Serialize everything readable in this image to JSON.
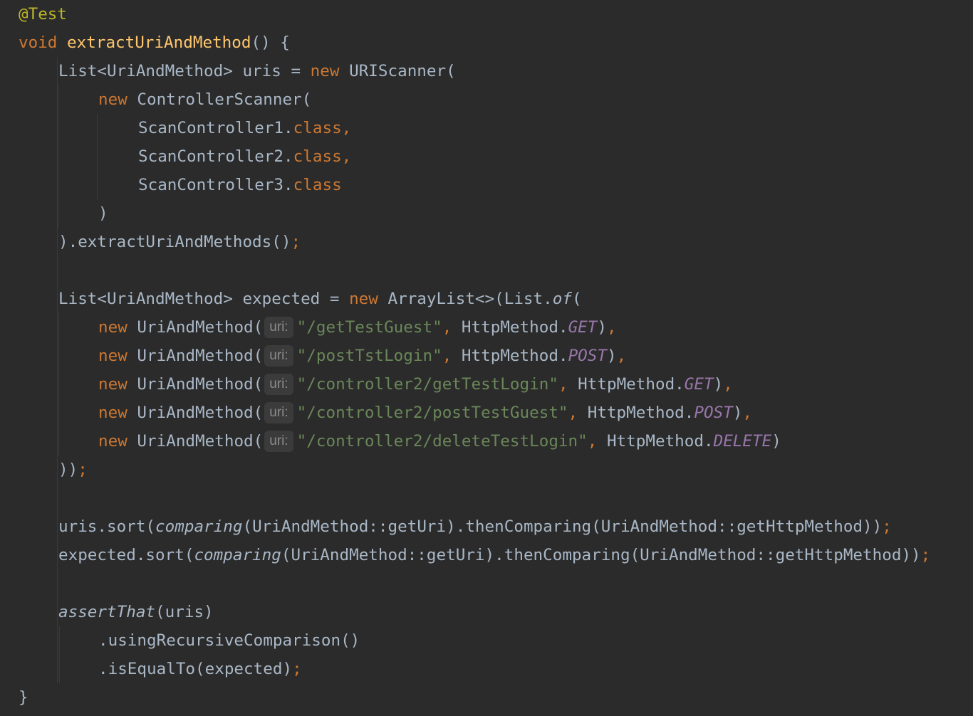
{
  "code": {
    "annotation": "@Test",
    "kw_void": "void",
    "method_name": "extractUriAndMethod",
    "method_open": "() {",
    "l3_a": "List<UriAndMethod> uris = ",
    "kw_new": "new",
    "l3_b": " URIScanner(",
    "l4_b": " ControllerScanner(",
    "c1": "ScanController1.",
    "c2": "ScanController2.",
    "c3": "ScanController3.",
    "kw_class": "class",
    "comma": ",",
    "close_paren": ")",
    "l9": ").extractUriAndMethods()",
    "semicolon": ";",
    "l11_a": "List<UriAndMethod> expected = ",
    "l11_b": " ArrayList<>(List.",
    "of": "of",
    "open_paren": "(",
    "uam_ctor": " UriAndMethod(",
    "hint_uri": "uri:",
    "u1": "\"/getTestGuest\"",
    "u2": "\"/postTstLogin\"",
    "u3": "\"/controller2/getTestLogin\"",
    "u4": "\"/controller2/postTestGuest\"",
    "u5": "\"/controller2/deleteTestLogin\"",
    "sep": ", ",
    "http_method": "HttpMethod.",
    "get": "GET",
    "post": "POST",
    "delete": "DELETE",
    "close_item": "),",
    "l17": "))",
    "sort_uris": "uris.sort(",
    "sort_expected": "expected.sort(",
    "comparing": "comparing",
    "sort_args": "(UriAndMethod::getUri).thenComparing(UriAndMethod::getHttpMethod))",
    "assert_that": "assertThat",
    "assert_args": "(uris)",
    "using_rec": ".usingRecursiveComparison()",
    "is_equal": ".isEqualTo(expected)",
    "close_brace": "}"
  }
}
